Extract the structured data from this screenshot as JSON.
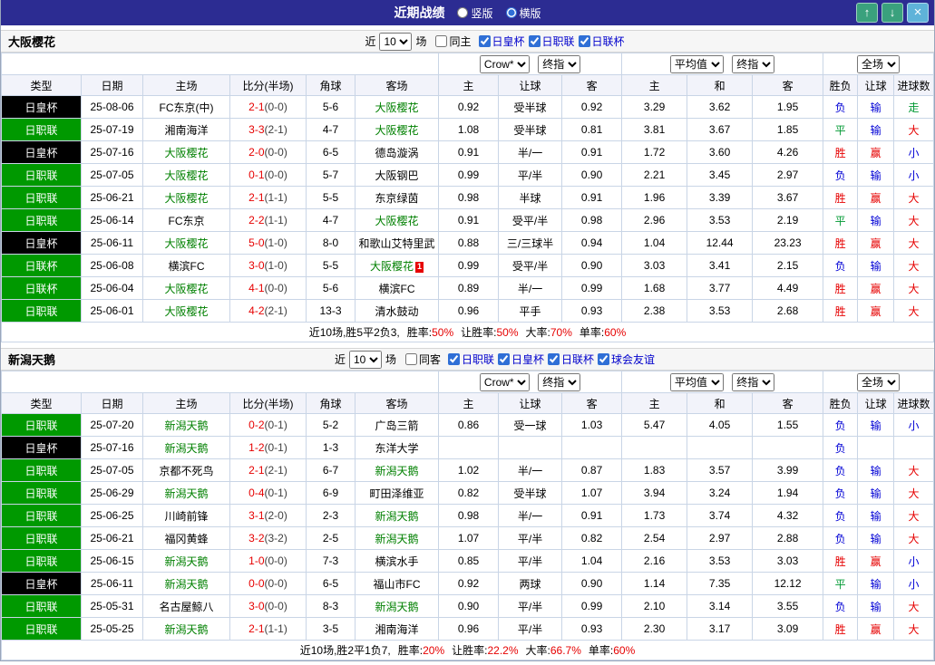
{
  "topbar": {
    "title": "近期战绩",
    "vertical_label": "竖版",
    "horizontal_label": "横版",
    "vertical_selected": false,
    "horizontal_selected": true,
    "up_icon": "↑",
    "down_icon": "↓",
    "close_icon": "×"
  },
  "dropdowns": {
    "odds_book": "Crow*",
    "odds_time": "终指",
    "euro_book": "平均值",
    "euro_time": "终指",
    "scope": "全场"
  },
  "table": {
    "columns": [
      "类型",
      "日期",
      "主场",
      "比分(半场)",
      "角球",
      "客场",
      "主",
      "让球",
      "客",
      "主",
      "和",
      "客",
      "胜负",
      "让球",
      "进球数"
    ]
  },
  "sections": [
    {
      "team": "大阪樱花",
      "filters": {
        "near_label": "近",
        "count": "10",
        "unit_label": "场",
        "same_label": "同主",
        "same_checked": false,
        "leagues": [
          {
            "label": "日皇杯",
            "checked": true
          },
          {
            "label": "日职联",
            "checked": true
          },
          {
            "label": "日联杯",
            "checked": true
          }
        ]
      },
      "rows": [
        {
          "type": "日皇杯",
          "date": "25-08-06",
          "home": "FC东京(中)",
          "score": "2-1",
          "half": "(0-0)",
          "corner": "5-6",
          "away": "大阪樱花",
          "asian": [
            "0.92",
            "受半球",
            "0.92"
          ],
          "euro": [
            "3.29",
            "3.62",
            "1.95"
          ],
          "results": [
            "负",
            "输",
            "走"
          ]
        },
        {
          "type": "日职联",
          "date": "25-07-19",
          "home": "湘南海洋",
          "score": "3-3",
          "half": "(2-1)",
          "corner": "4-7",
          "away": "大阪樱花",
          "asian": [
            "1.08",
            "受半球",
            "0.81"
          ],
          "euro": [
            "3.81",
            "3.67",
            "1.85"
          ],
          "results": [
            "平",
            "输",
            "大"
          ]
        },
        {
          "type": "日皇杯",
          "date": "25-07-16",
          "home": "大阪樱花",
          "score": "2-0",
          "half": "(0-0)",
          "corner": "6-5",
          "away": "德岛漩涡",
          "asian": [
            "0.91",
            "半/一",
            "0.91"
          ],
          "euro": [
            "1.72",
            "3.60",
            "4.26"
          ],
          "results": [
            "胜",
            "赢",
            "小"
          ]
        },
        {
          "type": "日职联",
          "date": "25-07-05",
          "home": "大阪樱花",
          "score": "0-1",
          "half": "(0-0)",
          "corner": "5-7",
          "away": "大阪钢巴",
          "asian": [
            "0.99",
            "平/半",
            "0.90"
          ],
          "euro": [
            "2.21",
            "3.45",
            "2.97"
          ],
          "results": [
            "负",
            "输",
            "小"
          ]
        },
        {
          "type": "日职联",
          "date": "25-06-21",
          "home": "大阪樱花",
          "score": "2-1",
          "half": "(1-1)",
          "corner": "5-5",
          "away": "东京绿茵",
          "asian": [
            "0.98",
            "半球",
            "0.91"
          ],
          "euro": [
            "1.96",
            "3.39",
            "3.67"
          ],
          "results": [
            "胜",
            "赢",
            "大"
          ]
        },
        {
          "type": "日职联",
          "date": "25-06-14",
          "home": "FC东京",
          "score": "2-2",
          "half": "(1-1)",
          "corner": "4-7",
          "away": "大阪樱花",
          "asian": [
            "0.91",
            "受平/半",
            "0.98"
          ],
          "euro": [
            "2.96",
            "3.53",
            "2.19"
          ],
          "results": [
            "平",
            "输",
            "大"
          ]
        },
        {
          "type": "日皇杯",
          "date": "25-06-11",
          "home": "大阪樱花",
          "score": "5-0",
          "half": "(1-0)",
          "corner": "8-0",
          "away": "和歌山艾特里武",
          "asian": [
            "0.88",
            "三/三球半",
            "0.94"
          ],
          "euro": [
            "1.04",
            "12.44",
            "23.23"
          ],
          "results": [
            "胜",
            "赢",
            "大"
          ]
        },
        {
          "type": "日联杯",
          "date": "25-06-08",
          "home": "横滨FC",
          "score": "3-0",
          "half": "(1-0)",
          "corner": "5-5",
          "away": "大阪樱花",
          "away_mark": "1",
          "asian": [
            "0.99",
            "受平/半",
            "0.90"
          ],
          "euro": [
            "3.03",
            "3.41",
            "2.15"
          ],
          "results": [
            "负",
            "输",
            "大"
          ]
        },
        {
          "type": "日联杯",
          "date": "25-06-04",
          "home": "大阪樱花",
          "score": "4-1",
          "half": "(0-0)",
          "corner": "5-6",
          "away": "横滨FC",
          "asian": [
            "0.89",
            "半/一",
            "0.99"
          ],
          "euro": [
            "1.68",
            "3.77",
            "4.49"
          ],
          "results": [
            "胜",
            "赢",
            "大"
          ]
        },
        {
          "type": "日职联",
          "date": "25-06-01",
          "home": "大阪樱花",
          "score": "4-2",
          "half": "(2-1)",
          "corner": "13-3",
          "away": "清水鼓动",
          "asian": [
            "0.96",
            "平手",
            "0.93"
          ],
          "euro": [
            "2.38",
            "3.53",
            "2.68"
          ],
          "results": [
            "胜",
            "赢",
            "大"
          ]
        }
      ],
      "summary": {
        "prefix": "近10场,胜5平2负3,",
        "stats": [
          {
            "label": "胜率:",
            "value": "50%"
          },
          {
            "label": "让胜率:",
            "value": "50%"
          },
          {
            "label": "大率:",
            "value": "70%"
          },
          {
            "label": "单率:",
            "value": "60%"
          }
        ]
      }
    },
    {
      "team": "新潟天鹅",
      "filters": {
        "near_label": "近",
        "count": "10",
        "unit_label": "场",
        "same_label": "同客",
        "same_checked": false,
        "leagues": [
          {
            "label": "日职联",
            "checked": true
          },
          {
            "label": "日皇杯",
            "checked": true
          },
          {
            "label": "日联杯",
            "checked": true
          },
          {
            "label": "球会友谊",
            "checked": true
          }
        ]
      },
      "rows": [
        {
          "type": "日职联",
          "date": "25-07-20",
          "home": "新潟天鹅",
          "score": "0-2",
          "half": "(0-1)",
          "corner": "5-2",
          "away": "广岛三箭",
          "asian": [
            "0.86",
            "受一球",
            "1.03"
          ],
          "euro": [
            "5.47",
            "4.05",
            "1.55"
          ],
          "results": [
            "负",
            "输",
            "小"
          ]
        },
        {
          "type": "日皇杯",
          "date": "25-07-16",
          "home": "新潟天鹅",
          "score": "1-2",
          "half": "(0-1)",
          "corner": "1-3",
          "away": "东洋大学",
          "asian": [
            "",
            "",
            ""
          ],
          "euro": [
            "",
            "",
            ""
          ],
          "results": [
            "负",
            "",
            ""
          ]
        },
        {
          "type": "日职联",
          "date": "25-07-05",
          "home": "京都不死鸟",
          "score": "2-1",
          "half": "(2-1)",
          "corner": "6-7",
          "away": "新潟天鹅",
          "asian": [
            "1.02",
            "半/一",
            "0.87"
          ],
          "euro": [
            "1.83",
            "3.57",
            "3.99"
          ],
          "results": [
            "负",
            "输",
            "大"
          ]
        },
        {
          "type": "日职联",
          "date": "25-06-29",
          "home": "新潟天鹅",
          "score": "0-4",
          "half": "(0-1)",
          "corner": "6-9",
          "away": "町田泽维亚",
          "asian": [
            "0.82",
            "受半球",
            "1.07"
          ],
          "euro": [
            "3.94",
            "3.24",
            "1.94"
          ],
          "results": [
            "负",
            "输",
            "大"
          ]
        },
        {
          "type": "日职联",
          "date": "25-06-25",
          "home": "川崎前锋",
          "score": "3-1",
          "half": "(2-0)",
          "corner": "2-3",
          "away": "新潟天鹅",
          "asian": [
            "0.98",
            "半/一",
            "0.91"
          ],
          "euro": [
            "1.73",
            "3.74",
            "4.32"
          ],
          "results": [
            "负",
            "输",
            "大"
          ]
        },
        {
          "type": "日职联",
          "date": "25-06-21",
          "home": "福冈黄蜂",
          "score": "3-2",
          "half": "(3-2)",
          "corner": "2-5",
          "away": "新潟天鹅",
          "asian": [
            "1.07",
            "平/半",
            "0.82"
          ],
          "euro": [
            "2.54",
            "2.97",
            "2.88"
          ],
          "results": [
            "负",
            "输",
            "大"
          ]
        },
        {
          "type": "日职联",
          "date": "25-06-15",
          "home": "新潟天鹅",
          "score": "1-0",
          "half": "(0-0)",
          "corner": "7-3",
          "away": "横滨水手",
          "asian": [
            "0.85",
            "平/半",
            "1.04"
          ],
          "euro": [
            "2.16",
            "3.53",
            "3.03"
          ],
          "results": [
            "胜",
            "赢",
            "小"
          ]
        },
        {
          "type": "日皇杯",
          "date": "25-06-11",
          "home": "新潟天鹅",
          "score": "0-0",
          "half": "(0-0)",
          "corner": "6-5",
          "away": "福山市FC",
          "asian": [
            "0.92",
            "两球",
            "0.90"
          ],
          "euro": [
            "1.14",
            "7.35",
            "12.12"
          ],
          "results": [
            "平",
            "输",
            "小"
          ]
        },
        {
          "type": "日职联",
          "date": "25-05-31",
          "home": "名古屋鲸八",
          "score": "3-0",
          "half": "(0-0)",
          "corner": "8-3",
          "away": "新潟天鹅",
          "asian": [
            "0.90",
            "平/半",
            "0.99"
          ],
          "euro": [
            "2.10",
            "3.14",
            "3.55"
          ],
          "results": [
            "负",
            "输",
            "大"
          ]
        },
        {
          "type": "日职联",
          "date": "25-05-25",
          "home": "新潟天鹅",
          "score": "2-1",
          "half": "(1-1)",
          "corner": "3-5",
          "away": "湘南海洋",
          "asian": [
            "0.96",
            "平/半",
            "0.93"
          ],
          "euro": [
            "2.30",
            "3.17",
            "3.09"
          ],
          "results": [
            "胜",
            "赢",
            "大"
          ]
        }
      ],
      "summary": {
        "prefix": "近10场,胜2平1负7,",
        "stats": [
          {
            "label": "胜率:",
            "value": "20%"
          },
          {
            "label": "让胜率:",
            "value": "22.2%"
          },
          {
            "label": "大率:",
            "value": "66.7%"
          },
          {
            "label": "单率:",
            "value": "60%"
          }
        ]
      }
    }
  ]
}
